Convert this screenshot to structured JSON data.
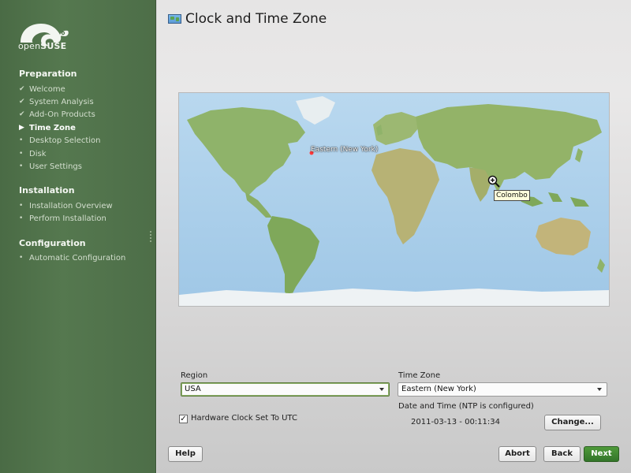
{
  "sidebar": {
    "logo": {
      "prefix": "open",
      "suffix": "SUSE"
    },
    "sections": [
      {
        "title": "Preparation",
        "items": [
          {
            "label": "Welcome",
            "state": "done"
          },
          {
            "label": "System Analysis",
            "state": "done"
          },
          {
            "label": "Add-On Products",
            "state": "done"
          },
          {
            "label": "Time Zone",
            "state": "current"
          },
          {
            "label": "Desktop Selection",
            "state": "pending"
          },
          {
            "label": "Disk",
            "state": "pending"
          },
          {
            "label": "User Settings",
            "state": "pending"
          }
        ]
      },
      {
        "title": "Installation",
        "items": [
          {
            "label": "Installation Overview",
            "state": "pending"
          },
          {
            "label": "Perform Installation",
            "state": "pending"
          }
        ]
      },
      {
        "title": "Configuration",
        "items": [
          {
            "label": "Automatic Configuration",
            "state": "pending"
          }
        ]
      }
    ]
  },
  "header": {
    "title": "Clock and Time Zone",
    "icon": "world-map-icon"
  },
  "map": {
    "selected_zone_label": "Eastern (New York)",
    "hover_tooltip": "Colombo",
    "zoom_icon": "magnifier-plus-icon"
  },
  "form": {
    "region_label": "Region",
    "region_value": "USA",
    "timezone_label": "Time Zone",
    "timezone_value": "Eastern (New York)",
    "hwclock_label": "Hardware Clock Set To UTC",
    "hwclock_checked": true,
    "datetime_label": "Date and Time (NTP is configured)",
    "datetime_value": "2011-03-13 - 00:11:34",
    "change_button": "Change..."
  },
  "footer": {
    "help": "Help",
    "abort": "Abort",
    "back": "Back",
    "next": "Next"
  },
  "colors": {
    "sidebar_green": "#55784f",
    "next_button_green": "#3a7d2e",
    "ocean": "#a9cde9",
    "land": "#8fb36a"
  }
}
